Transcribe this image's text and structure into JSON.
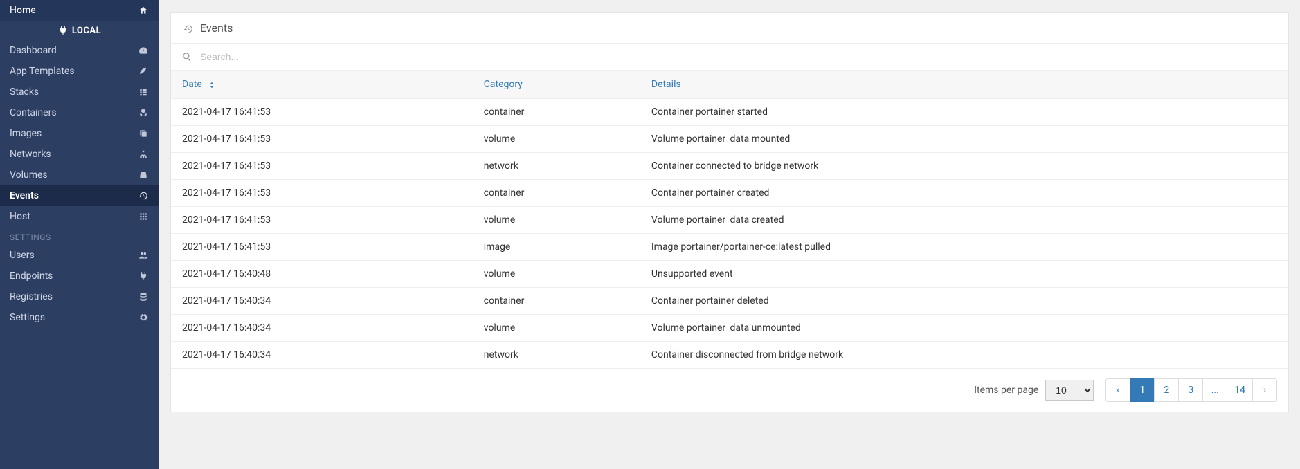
{
  "sidebar": {
    "home": "Home",
    "env_label": "LOCAL",
    "items": [
      {
        "label": "Dashboard",
        "icon": "gauge-icon"
      },
      {
        "label": "App Templates",
        "icon": "rocket-icon"
      },
      {
        "label": "Stacks",
        "icon": "list-icon"
      },
      {
        "label": "Containers",
        "icon": "cubes-icon"
      },
      {
        "label": "Images",
        "icon": "clone-icon"
      },
      {
        "label": "Networks",
        "icon": "sitemap-icon"
      },
      {
        "label": "Volumes",
        "icon": "hdd-icon"
      },
      {
        "label": "Events",
        "icon": "history-icon"
      },
      {
        "label": "Host",
        "icon": "grid-icon"
      }
    ],
    "settings_header": "SETTINGS",
    "settings": [
      {
        "label": "Users",
        "icon": "users-icon"
      },
      {
        "label": "Endpoints",
        "icon": "plug-icon"
      },
      {
        "label": "Registries",
        "icon": "database-icon"
      },
      {
        "label": "Settings",
        "icon": "cogs-icon"
      }
    ]
  },
  "panel": {
    "title": "Events",
    "search_placeholder": "Search..."
  },
  "table": {
    "headers": {
      "date": "Date",
      "category": "Category",
      "details": "Details"
    },
    "rows": [
      {
        "date": "2021-04-17 16:41:53",
        "category": "container",
        "details": "Container portainer started"
      },
      {
        "date": "2021-04-17 16:41:53",
        "category": "volume",
        "details": "Volume portainer_data mounted"
      },
      {
        "date": "2021-04-17 16:41:53",
        "category": "network",
        "details": "Container connected to bridge network"
      },
      {
        "date": "2021-04-17 16:41:53",
        "category": "container",
        "details": "Container portainer created"
      },
      {
        "date": "2021-04-17 16:41:53",
        "category": "volume",
        "details": "Volume portainer_data created"
      },
      {
        "date": "2021-04-17 16:41:53",
        "category": "image",
        "details": "Image portainer/portainer-ce:latest pulled"
      },
      {
        "date": "2021-04-17 16:40:48",
        "category": "volume",
        "details": "Unsupported event"
      },
      {
        "date": "2021-04-17 16:40:34",
        "category": "container",
        "details": "Container portainer deleted"
      },
      {
        "date": "2021-04-17 16:40:34",
        "category": "volume",
        "details": "Volume portainer_data unmounted"
      },
      {
        "date": "2021-04-17 16:40:34",
        "category": "network",
        "details": "Container disconnected from bridge network"
      }
    ]
  },
  "footer": {
    "items_per_page_label": "Items per page",
    "items_per_page_value": "10",
    "pages": [
      "1",
      "2",
      "3",
      "...",
      "14"
    ],
    "prev": "‹",
    "next": "›",
    "active_page": "1"
  }
}
